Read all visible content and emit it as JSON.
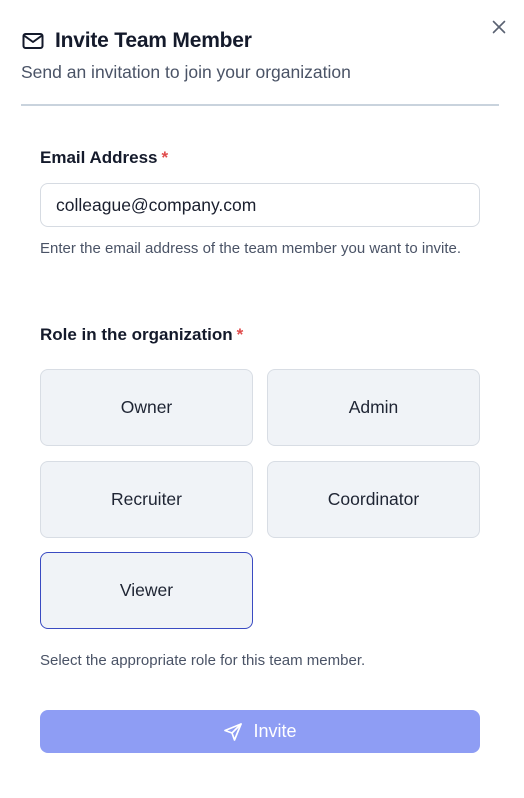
{
  "dialog": {
    "title": "Invite Team Member",
    "subtitle": "Send an invitation to join your organization",
    "title_icon": "mail-icon",
    "close_icon": "close-icon"
  },
  "email": {
    "label": "Email Address",
    "required_marker": "*",
    "value": "colleague@company.com",
    "help": "Enter the email address of the team member you want to invite."
  },
  "role": {
    "label": "Role in the organization",
    "required_marker": "*",
    "options": [
      "Owner",
      "Admin",
      "Recruiter",
      "Coordinator",
      "Viewer"
    ],
    "selected": "Viewer",
    "help": "Select the appropriate role for this team member."
  },
  "submit": {
    "label": "Invite",
    "icon": "send-icon"
  },
  "colors": {
    "accent": "#8e9df4",
    "selected_border": "#3a4bc2",
    "required": "#e04a4a"
  }
}
